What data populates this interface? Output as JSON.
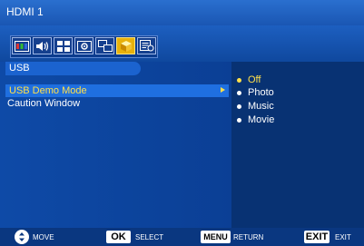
{
  "header": {
    "title": "HDMI 1"
  },
  "icon_bar": {
    "icons": [
      "picture-icon",
      "audio-icon",
      "schedule-icon",
      "setup-icon",
      "input-icon",
      "usb-icon",
      "option-icon"
    ],
    "active": "usb-icon"
  },
  "menu": {
    "section_title": "USB",
    "items": [
      {
        "label": "USB Demo Mode",
        "selected": true
      },
      {
        "label": "Caution Window",
        "selected": false
      }
    ]
  },
  "options": {
    "items": [
      "Off",
      "Photo",
      "Music",
      "Movie"
    ],
    "selected": "Off"
  },
  "footer": {
    "move_label": "MOVE",
    "ok_key": "OK",
    "select_label": "SELECT",
    "menu_key": "MENU",
    "return_label": "RETURN",
    "exit_key": "EXIT",
    "exit_label": "EXIT"
  },
  "colors": {
    "background": "#0a3a86",
    "highlight": "#1f6fe0",
    "selected_text": "#ffe04a",
    "active_icon": "#e8b10b"
  }
}
